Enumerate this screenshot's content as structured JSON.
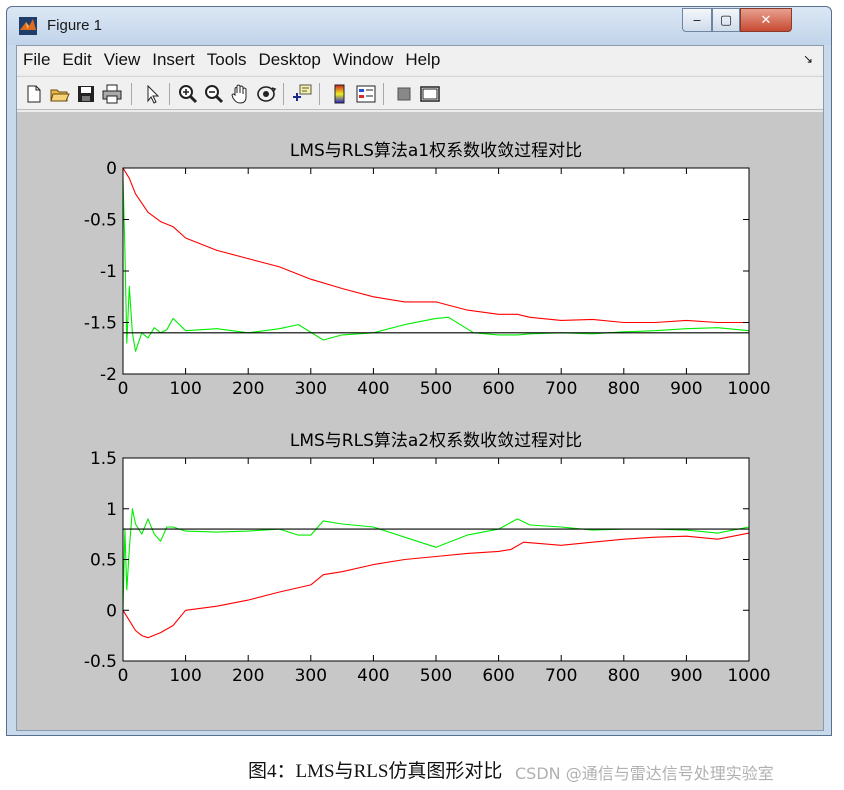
{
  "window": {
    "title": "Figure 1",
    "controls": {
      "minimize": "‒",
      "maximize": "▢",
      "close": "✕"
    }
  },
  "menubar": {
    "items": [
      "File",
      "Edit",
      "View",
      "Insert",
      "Tools",
      "Desktop",
      "Window",
      "Help"
    ],
    "overflow_glyph": "↘"
  },
  "toolbar": {
    "buttons": [
      "new-figure-icon",
      "open-file-icon",
      "save-icon",
      "print-icon",
      "edit-plot-arrow-icon",
      "zoom-in-icon",
      "zoom-out-icon",
      "pan-hand-icon",
      "rotate-3d-icon",
      "data-cursor-icon",
      "colorbar-icon",
      "legend-icon",
      "hide-plot-tools-icon",
      "show-plot-tools-icon"
    ]
  },
  "colors": {
    "lms": "#ff0000",
    "rls": "#00ee00",
    "true": "#000000"
  },
  "chart_data": [
    {
      "type": "line",
      "title": "LMS与RLS算法a1权系数收敛过程对比",
      "xlim": [
        0,
        1000
      ],
      "ylim": [
        -2,
        0
      ],
      "xticks": [
        "0",
        "100",
        "200",
        "300",
        "400",
        "500",
        "600",
        "700",
        "800",
        "900",
        "1000"
      ],
      "yticks": [
        "0",
        "-0.5",
        "-1",
        "-1.5",
        "-2"
      ],
      "grid": false,
      "series": [
        {
          "color": "#ff0000",
          "x": [
            0,
            10,
            20,
            40,
            60,
            80,
            100,
            150,
            200,
            250,
            300,
            350,
            400,
            450,
            500,
            550,
            600,
            630,
            650,
            700,
            750,
            800,
            850,
            900,
            950,
            1000
          ],
          "y": [
            0,
            -0.1,
            -0.25,
            -0.43,
            -0.52,
            -0.57,
            -0.68,
            -0.8,
            -0.88,
            -0.96,
            -1.08,
            -1.17,
            -1.25,
            -1.3,
            -1.3,
            -1.38,
            -1.42,
            -1.42,
            -1.45,
            -1.48,
            -1.47,
            -1.5,
            -1.5,
            -1.48,
            -1.5,
            -1.5
          ]
        },
        {
          "color": "#00ee00",
          "x": [
            0,
            3,
            6,
            10,
            15,
            20,
            30,
            40,
            50,
            60,
            70,
            80,
            100,
            150,
            200,
            250,
            280,
            320,
            350,
            400,
            450,
            500,
            520,
            560,
            600,
            630,
            650,
            700,
            750,
            800,
            850,
            900,
            950,
            1000
          ],
          "y": [
            -0.1,
            -0.8,
            -1.7,
            -1.15,
            -1.6,
            -1.78,
            -1.6,
            -1.65,
            -1.55,
            -1.6,
            -1.57,
            -1.46,
            -1.58,
            -1.56,
            -1.6,
            -1.56,
            -1.52,
            -1.67,
            -1.62,
            -1.6,
            -1.52,
            -1.46,
            -1.45,
            -1.6,
            -1.62,
            -1.62,
            -1.61,
            -1.6,
            -1.61,
            -1.59,
            -1.58,
            -1.56,
            -1.55,
            -1.58
          ]
        },
        {
          "color": "#000000",
          "x": [
            0,
            1000
          ],
          "y": [
            -1.6,
            -1.6
          ]
        }
      ]
    },
    {
      "type": "line",
      "title": "LMS与RLS算法a2权系数收敛过程对比",
      "xlim": [
        0,
        1000
      ],
      "ylim": [
        -0.5,
        1.5
      ],
      "xticks": [
        "0",
        "100",
        "200",
        "300",
        "400",
        "500",
        "600",
        "700",
        "800",
        "900",
        "1000"
      ],
      "yticks": [
        "1.5",
        "1",
        "0.5",
        "0",
        "-0.5"
      ],
      "grid": false,
      "series": [
        {
          "color": "#ff0000",
          "x": [
            0,
            10,
            20,
            30,
            40,
            60,
            80,
            100,
            150,
            200,
            250,
            300,
            320,
            350,
            400,
            450,
            500,
            550,
            600,
            620,
            640,
            700,
            750,
            800,
            850,
            900,
            950,
            1000
          ],
          "y": [
            0,
            -0.1,
            -0.2,
            -0.25,
            -0.27,
            -0.22,
            -0.15,
            0,
            0.04,
            0.1,
            0.18,
            0.25,
            0.35,
            0.38,
            0.45,
            0.5,
            0.53,
            0.56,
            0.58,
            0.6,
            0.67,
            0.64,
            0.67,
            0.7,
            0.72,
            0.73,
            0.7,
            0.76
          ]
        },
        {
          "color": "#00ee00",
          "x": [
            0,
            3,
            6,
            10,
            15,
            20,
            30,
            40,
            50,
            60,
            70,
            80,
            100,
            150,
            200,
            250,
            280,
            300,
            320,
            350,
            400,
            450,
            500,
            550,
            600,
            630,
            650,
            700,
            750,
            800,
            850,
            900,
            950,
            1000
          ],
          "y": [
            0,
            0.8,
            0.2,
            0.6,
            1.0,
            0.85,
            0.75,
            0.9,
            0.75,
            0.68,
            0.82,
            0.82,
            0.78,
            0.77,
            0.78,
            0.8,
            0.74,
            0.74,
            0.88,
            0.85,
            0.82,
            0.72,
            0.62,
            0.74,
            0.8,
            0.9,
            0.84,
            0.82,
            0.79,
            0.8,
            0.8,
            0.79,
            0.76,
            0.82
          ]
        },
        {
          "color": "#000000",
          "x": [
            0,
            1000
          ],
          "y": [
            0.8,
            0.8
          ]
        }
      ]
    }
  ],
  "caption": "图4：LMS与RLS仿真图形对比",
  "watermark": "CSDN @通信与雷达信号处理实验室"
}
